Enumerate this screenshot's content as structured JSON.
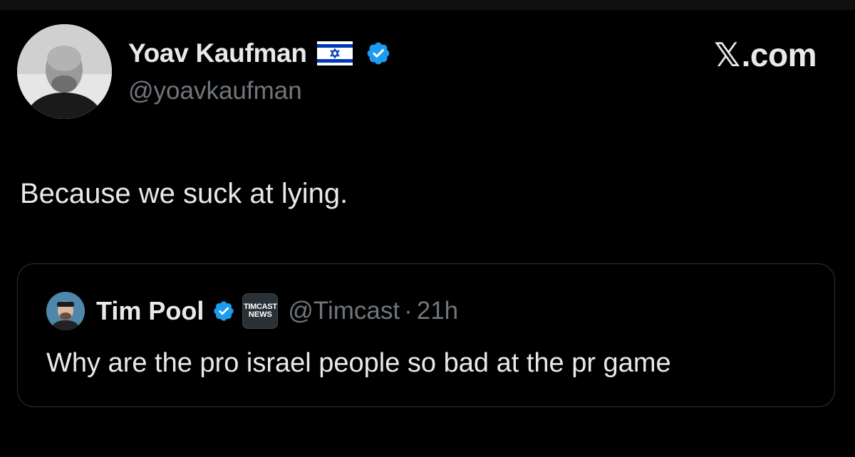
{
  "tweet": {
    "author": {
      "name": "Yoav Kaufman",
      "handle": "@yoavkaufman",
      "flag": "israel-flag-icon",
      "verified": true,
      "avatar": "avatar-photo"
    },
    "text": "Because we suck at lying."
  },
  "brand": {
    "x_glyph": "𝕏",
    "domain": ".com"
  },
  "quoted_tweet": {
    "author": {
      "name": "Tim Pool",
      "handle": "@Timcast",
      "verified": true,
      "affiliate_badge": {
        "line1": "TIMCAST",
        "line2": "NEWS"
      },
      "avatar": "avatar-photo"
    },
    "separator": "·",
    "time": "21h",
    "text": "Why are the pro israel people so bad at the pr game"
  },
  "colors": {
    "background": "#000000",
    "primary_text": "#e7e9ea",
    "secondary_text": "#71767b",
    "verified_blue": "#1d9bf0",
    "card_border": "#2f3336",
    "flag_blue": "#0038b8"
  }
}
